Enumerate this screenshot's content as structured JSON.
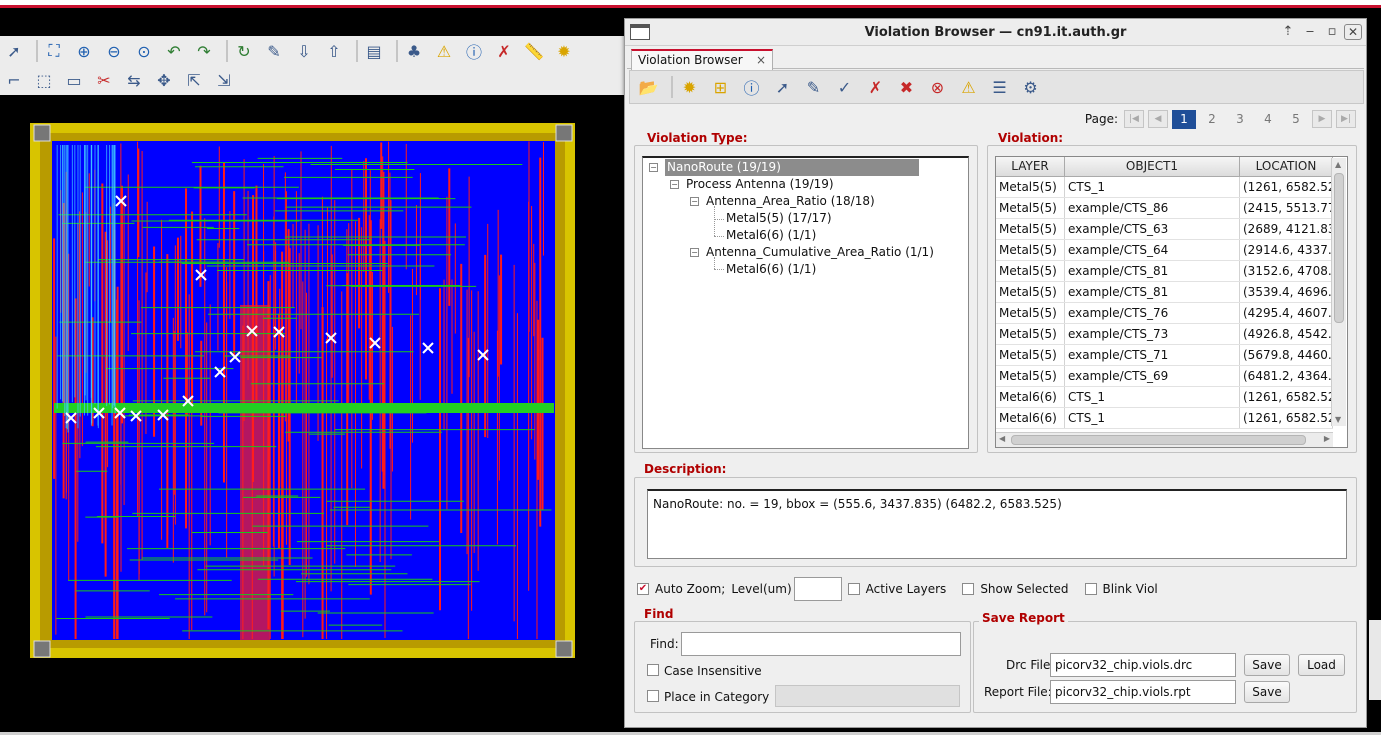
{
  "window": {
    "title": "Violation Browser — cn91.it.auth.gr",
    "tab_label": "Violation Browser",
    "tab_close": "×"
  },
  "window_controls": {
    "up": "⇡",
    "minimize": "‒",
    "maximize": "▫",
    "close": "✕"
  },
  "pager": {
    "label": "Page:",
    "pages": [
      "1",
      "2",
      "3",
      "4",
      "5"
    ],
    "current": "1"
  },
  "violation_type": {
    "title": "Violation Type:",
    "tree": [
      {
        "label": "NanoRoute (19/19)"
      },
      {
        "label": "Process Antenna (19/19)"
      },
      {
        "label": "Antenna_Area_Ratio (18/18)"
      },
      {
        "label": "Metal5(5) (17/17)"
      },
      {
        "label": "Metal6(6) (1/1)"
      },
      {
        "label": "Antenna_Cumulative_Area_Ratio (1/1)"
      },
      {
        "label": "Metal6(6) (1/1)"
      }
    ]
  },
  "violation": {
    "title": "Violation:",
    "columns": [
      "LAYER",
      "OBJECT1",
      "LOCATION"
    ],
    "rows": [
      [
        "Metal5(5)",
        "CTS_1",
        "(1261, 6582.52..."
      ],
      [
        "Metal5(5)",
        "example/CTS_86",
        "(2415, 5513.77..."
      ],
      [
        "Metal5(5)",
        "example/CTS_63",
        "(2689, 4121.83..."
      ],
      [
        "Metal5(5)",
        "example/CTS_64",
        "(2914.6, 4337...."
      ],
      [
        "Metal5(5)",
        "example/CTS_81",
        "(3152.6, 4708...."
      ],
      [
        "Metal5(5)",
        "example/CTS_81",
        "(3539.4, 4696...."
      ],
      [
        "Metal5(5)",
        "example/CTS_76",
        "(4295.4, 4607...."
      ],
      [
        "Metal5(5)",
        "example/CTS_73",
        "(4926.8, 4542...."
      ],
      [
        "Metal5(5)",
        "example/CTS_71",
        "(5679.8, 4460...."
      ],
      [
        "Metal5(5)",
        "example/CTS_69",
        "(6481.2, 4364...."
      ],
      [
        "Metal6(6)",
        "CTS_1",
        "(1261, 6582.52..."
      ],
      [
        "Metal6(6)",
        "CTS_1",
        "(1261, 6582.52..."
      ]
    ]
  },
  "description": {
    "title": "Description:",
    "text": "NanoRoute: no. = 19, bbox = (555.6, 3437.835) (6482.2, 6583.525)"
  },
  "options": {
    "auto_zoom": "Auto Zoom;",
    "level_label": "Level(um)",
    "level_value": "",
    "active_layers": "Active Layers",
    "show_selected": "Show Selected",
    "blink_viol": "Blink Viol"
  },
  "find": {
    "title": "Find",
    "find_label": "Find:",
    "find_value": "",
    "case_insensitive": "Case Insensitive",
    "place_in_category": "Place in Category",
    "category_value": ""
  },
  "save_report": {
    "title": "Save Report",
    "drc_label": "Drc File:",
    "drc_value": "picorv32_chip.viols.drc",
    "report_label": "Report File:",
    "report_value": "picorv32_chip.viols.rpt",
    "save": "Save",
    "load": "Load"
  },
  "colors": {
    "accent": "#c8102e",
    "title_red": "#b00000",
    "selection": "#1f4e98",
    "die_blue": "#0000ff",
    "pad_yellow": "#e8d000"
  },
  "toolbar_row1_icons": [
    "select-icon",
    "zoom-fit-icon",
    "zoom-in-icon",
    "zoom-out-icon",
    "zoom-select-icon",
    "undo-icon",
    "redo-icon",
    "refresh-icon",
    "highlight-icon",
    "move-down-icon",
    "move-up-icon",
    "panel-icon",
    "hierarchy-icon",
    "warning-icon",
    "info-icon",
    "clear-icon",
    "ruler-icon",
    "violation-icon"
  ],
  "toolbar_row2_icons": [
    "wire-icon",
    "select-box-icon",
    "area-icon",
    "cut-icon",
    "stretch-icon",
    "move-icon",
    "cursor-icon",
    "hierarchy-move-icon"
  ],
  "dialog_toolbar_icons": [
    "open-folder-icon",
    "load-violations-icon",
    "zoom-violation-icon",
    "info-icon",
    "select-arrow-icon",
    "highlight-icon",
    "fix-icon",
    "mark-icon",
    "delete-icon",
    "stop-icon",
    "warning-icon",
    "settings-list-icon",
    "gear-icon"
  ]
}
